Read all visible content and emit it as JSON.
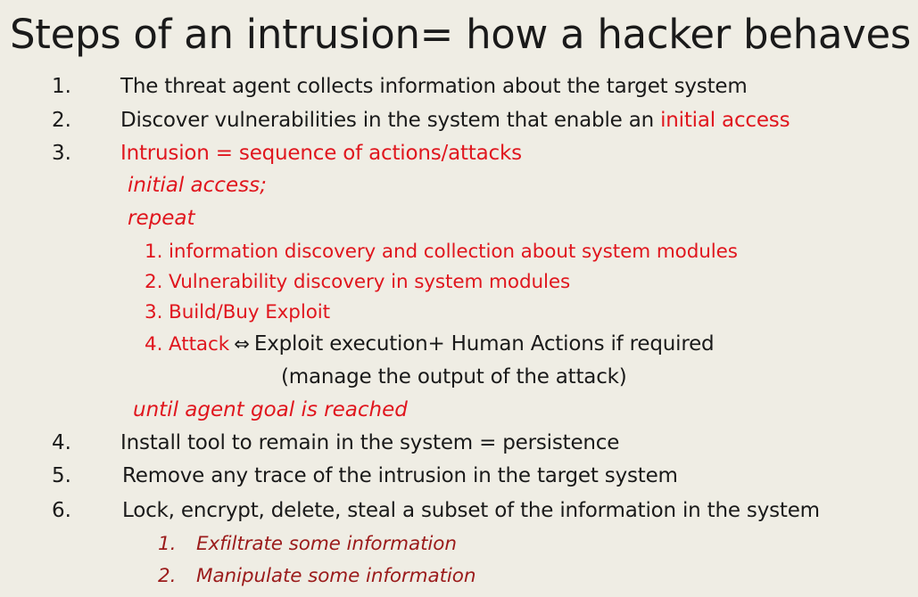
{
  "title": "Steps of an intrusion= how a hacker behaves",
  "steps": [
    {
      "num": "1.",
      "text": "The threat agent collects information about the target system"
    },
    {
      "num": "2.",
      "text": "Discover vulnerabilities in the system that enable an ",
      "highlight": "initial access"
    },
    {
      "num": "3.",
      "text": "Intrusion = sequence of actions/attacks"
    },
    {
      "num": "4.",
      "text": "Install tool to remain in the system = persistence"
    },
    {
      "num": "5.",
      "text": "Remove any trace of the intrusion in the target system"
    },
    {
      "num": "6.",
      "text": "Lock, encrypt, delete, steal a subset of the information in the system"
    }
  ],
  "loop": {
    "initial": "initial access;",
    "repeat": "repeat",
    "items": [
      "1. information discovery and collection about system modules",
      "2. Vulnerability discovery in system modules",
      "3. Build/Buy Exploit"
    ],
    "attack_label": "4. Attack",
    "attack_arrow": "⇔",
    "attack_desc": "Exploit execution+ Human Actions if required",
    "attack_note": "(manage the output of the attack)",
    "until": "until agent goal is reached"
  },
  "substeps": [
    {
      "num": "1.",
      "text": "Exfiltrate some information"
    },
    {
      "num": "2.",
      "text": "Manipulate some information"
    }
  ],
  "colors": {
    "background": "#efede4",
    "red": "#e0161e",
    "dark_red": "#9b1b1b",
    "text": "#1a1a1a"
  }
}
